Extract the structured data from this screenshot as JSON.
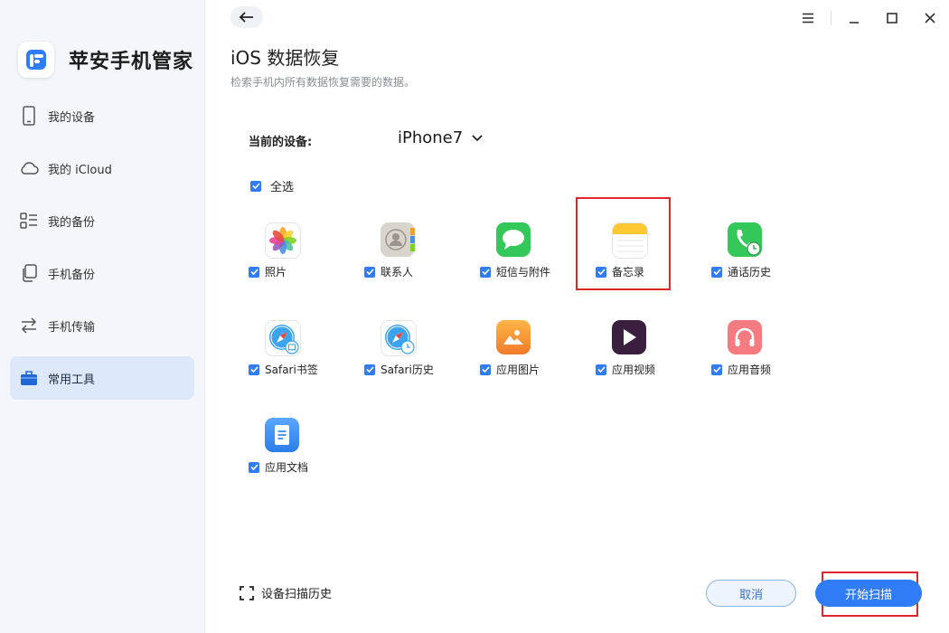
{
  "app": {
    "name": "苹安手机管家",
    "accent": "#2f7cf6",
    "highlight": "#e0262d"
  },
  "sidebar": {
    "items": [
      {
        "label": "我的设备",
        "icon": "phone-icon",
        "active": false
      },
      {
        "label": "我的 iCloud",
        "icon": "cloud-icon",
        "active": false
      },
      {
        "label": "我的备份",
        "icon": "list-icon",
        "active": false
      },
      {
        "label": "手机备份",
        "icon": "copy-icon",
        "active": false
      },
      {
        "label": "手机传输",
        "icon": "transfer-arrows-icon",
        "active": false
      },
      {
        "label": "常用工具",
        "icon": "toolbox-icon",
        "active": true
      }
    ]
  },
  "window_controls": [
    "menu-icon",
    "minimize-icon",
    "maximize-icon",
    "close-icon"
  ],
  "header": {
    "title": "iOS 数据恢复",
    "subtitle": "检索手机内所有数据恢复需要的数据。"
  },
  "device": {
    "label": "当前的设备:",
    "selected": "iPhone7"
  },
  "select_all": {
    "label": "全选",
    "checked": true
  },
  "categories": [
    {
      "label": "照片",
      "icon": "photos-icon",
      "checked": true
    },
    {
      "label": "联系人",
      "icon": "contacts-icon",
      "checked": true
    },
    {
      "label": "短信与附件",
      "icon": "messages-icon",
      "checked": true
    },
    {
      "label": "备忘录",
      "icon": "notes-icon",
      "checked": true
    },
    {
      "label": "通话历史",
      "icon": "call-history-icon",
      "checked": true
    },
    {
      "label": "Safari书签",
      "icon": "safari-bookmark-icon",
      "checked": true
    },
    {
      "label": "Safari历史",
      "icon": "safari-history-icon",
      "checked": true
    },
    {
      "label": "应用图片",
      "icon": "app-photo-icon",
      "checked": true
    },
    {
      "label": "应用视频",
      "icon": "app-video-icon",
      "checked": true
    },
    {
      "label": "应用音频",
      "icon": "app-audio-icon",
      "checked": true
    },
    {
      "label": "应用文档",
      "icon": "app-document-icon",
      "checked": true
    }
  ],
  "footer": {
    "scan_history": "设备扫描历史",
    "cancel": "取消",
    "start": "开始扫描"
  }
}
